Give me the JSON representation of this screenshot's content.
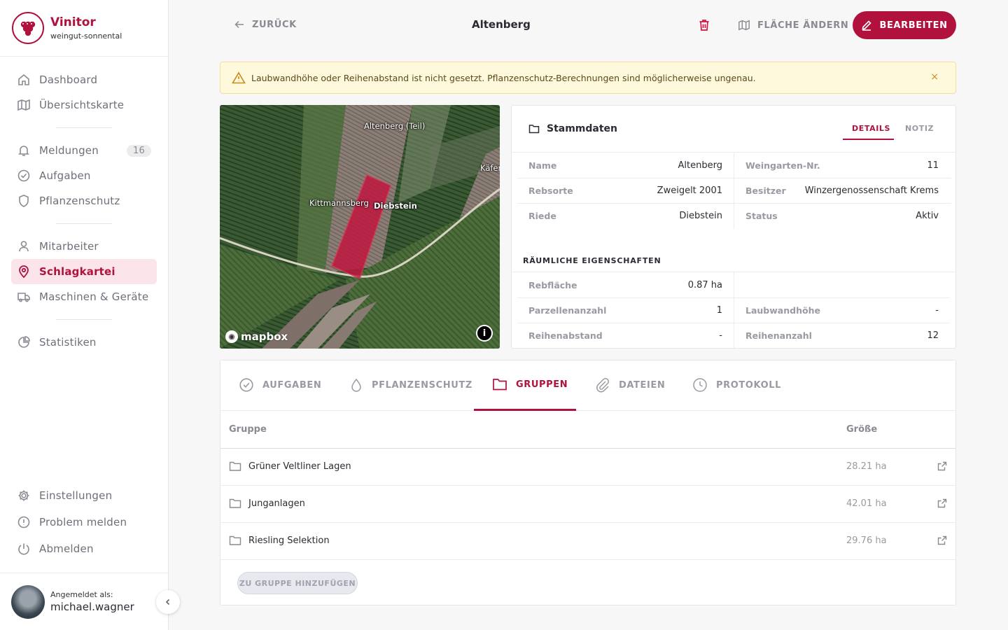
{
  "brand": {
    "name": "Vinitor",
    "subtitle": "weingut-sonnental"
  },
  "nav": {
    "dashboard": "Dashboard",
    "overview_map": "Übersichtskarte",
    "messages": "Meldungen",
    "messages_count": "16",
    "tasks": "Aufgaben",
    "plant_protection": "Pflanzenschutz",
    "employees": "Mitarbeiter",
    "field_register": "Schlagkartei",
    "machines": "Maschinen & Geräte",
    "statistics": "Statistiken",
    "settings": "Einstellungen",
    "report_problem": "Problem melden",
    "logout": "Abmelden"
  },
  "user": {
    "label": "Angemeldet als:",
    "name": "michael.wagner"
  },
  "header": {
    "back": "ZURÜCK",
    "title": "Altenberg",
    "change_area": "FLÄCHE ÄNDERN",
    "edit": "BEARBEITEN"
  },
  "alert": {
    "text": "Laubwandhöhe oder Reihenabstand ist nicht gesetzt. Pflanzenschutz-Berechnungen sind möglicherweise ungenau.",
    "close": "×"
  },
  "map": {
    "labels": {
      "altenberg": "Altenberg (Teil)",
      "kittmannsberg": "Kittmannsberg",
      "diebstein": "Diebstein",
      "kaefer": "Käfer"
    },
    "attribution": "mapbox",
    "info": "i",
    "colors": {
      "selected_field": "#c0173f"
    }
  },
  "stammdaten": {
    "title": "Stammdaten",
    "tab_details": "DETAILS",
    "tab_note": "NOTIZ",
    "left": [
      {
        "label": "Name",
        "value": "Altenberg"
      },
      {
        "label": "Rebsorte",
        "value": "Zweigelt 2001"
      },
      {
        "label": "Riede",
        "value": "Diebstein"
      }
    ],
    "right": [
      {
        "label": "Weingarten-Nr.",
        "value": "11"
      },
      {
        "label": "Besitzer",
        "value": "Winzergenossenschaft Krems"
      },
      {
        "label": "Status",
        "value": "Aktiv"
      }
    ],
    "spatial_title": "RÄUMLICHE EIGENSCHAFTEN",
    "spatial_left": [
      {
        "label": "Rebfläche",
        "value": "0.87 ha"
      },
      {
        "label": "Parzellenanzahl",
        "value": "1"
      },
      {
        "label": "Reihenabstand",
        "value": "-"
      }
    ],
    "spatial_right": [
      {
        "label": "Laubwandhöhe",
        "value": "-"
      },
      {
        "label": "Reihenanzahl",
        "value": "12"
      }
    ]
  },
  "tabs": {
    "tasks": "AUFGABEN",
    "plant_protection": "PFLANZENSCHUTZ",
    "groups": "GRUPPEN",
    "files": "DATEIEN",
    "log": "PROTOKOLL"
  },
  "groups_table": {
    "col_group": "Gruppe",
    "col_size": "Größe",
    "rows": [
      {
        "name": "Grüner Veltliner Lagen",
        "size": "28.21 ha"
      },
      {
        "name": "Junganlagen",
        "size": "42.01 ha"
      },
      {
        "name": "Riesling Selektion",
        "size": "29.76 ha"
      }
    ],
    "add_button": "ZU GRUPPE HINZUFÜGEN"
  },
  "colors": {
    "accent": "#b0123d",
    "accent_light": "#fbe4ea",
    "alert_bg": "#fef8dd"
  }
}
